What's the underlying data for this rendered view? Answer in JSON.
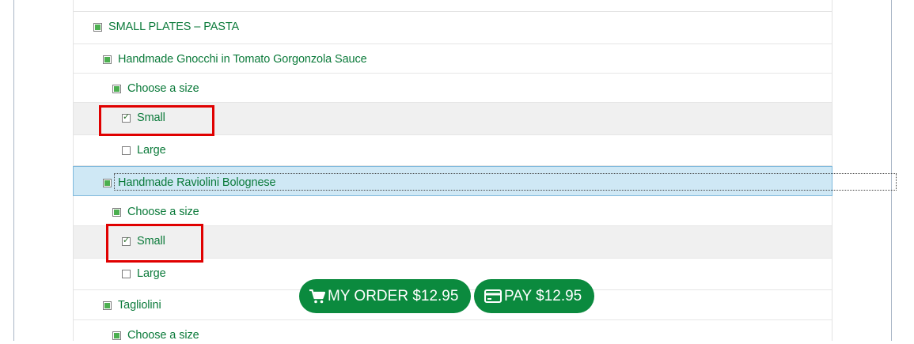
{
  "menu": {
    "section": "SMALL PLATES – PASTA",
    "items": [
      {
        "name": "Handmade Gnocchi in Tomato Gorgonzola Sauce",
        "group_label": "Choose a size",
        "options": [
          "Small",
          "Large"
        ]
      },
      {
        "name": "Handmade Raviolini Bolognese",
        "group_label": "Choose a size",
        "options": [
          "Small",
          "Large"
        ]
      },
      {
        "name": "Tagliolini",
        "group_label": "Choose a size"
      }
    ]
  },
  "selection": {
    "item0_small": true,
    "item0_large": false,
    "item1_small": true,
    "item1_large": false
  },
  "buttons": {
    "my_order": "MY ORDER $12.95",
    "pay": "PAY $12.95"
  },
  "icons": {
    "my_order": "shopping-cart-icon",
    "pay": "credit-card-icon"
  },
  "colors": {
    "text_green": "#0b7a3a",
    "button_green": "#0b8a3e",
    "selected_row": "#cfe8f5",
    "highlight_red": "#e00000"
  }
}
